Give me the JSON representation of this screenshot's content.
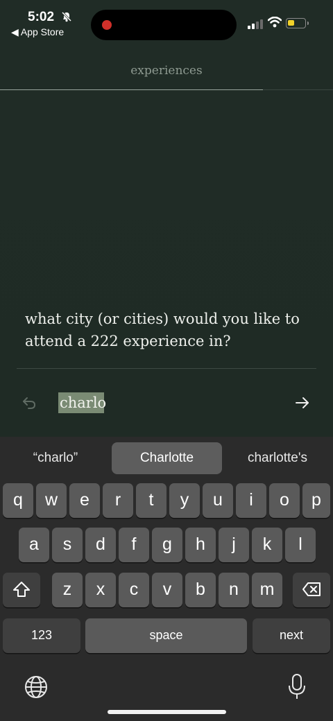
{
  "status_bar": {
    "time": "5:02",
    "back_label": "◀ App Store"
  },
  "header": {
    "title": "experiences",
    "progress": 0.79
  },
  "question": {
    "text": "what city (or cities) would you like to attend a 222 experience in?"
  },
  "answer": {
    "value": "charlo"
  },
  "keyboard": {
    "suggestions": [
      "“charlo”",
      "Charlotte",
      "charlotte's"
    ],
    "row1": [
      "q",
      "w",
      "e",
      "r",
      "t",
      "y",
      "u",
      "i",
      "o",
      "p"
    ],
    "row2": [
      "a",
      "s",
      "d",
      "f",
      "g",
      "h",
      "j",
      "k",
      "l"
    ],
    "row3": [
      "z",
      "x",
      "c",
      "v",
      "b",
      "n",
      "m"
    ],
    "numbers_label": "123",
    "space_label": "space",
    "next_label": "next"
  },
  "colors": {
    "background": "#1f2b25",
    "selection": "#7a8b74",
    "keyboard": "#2b2b2b"
  }
}
